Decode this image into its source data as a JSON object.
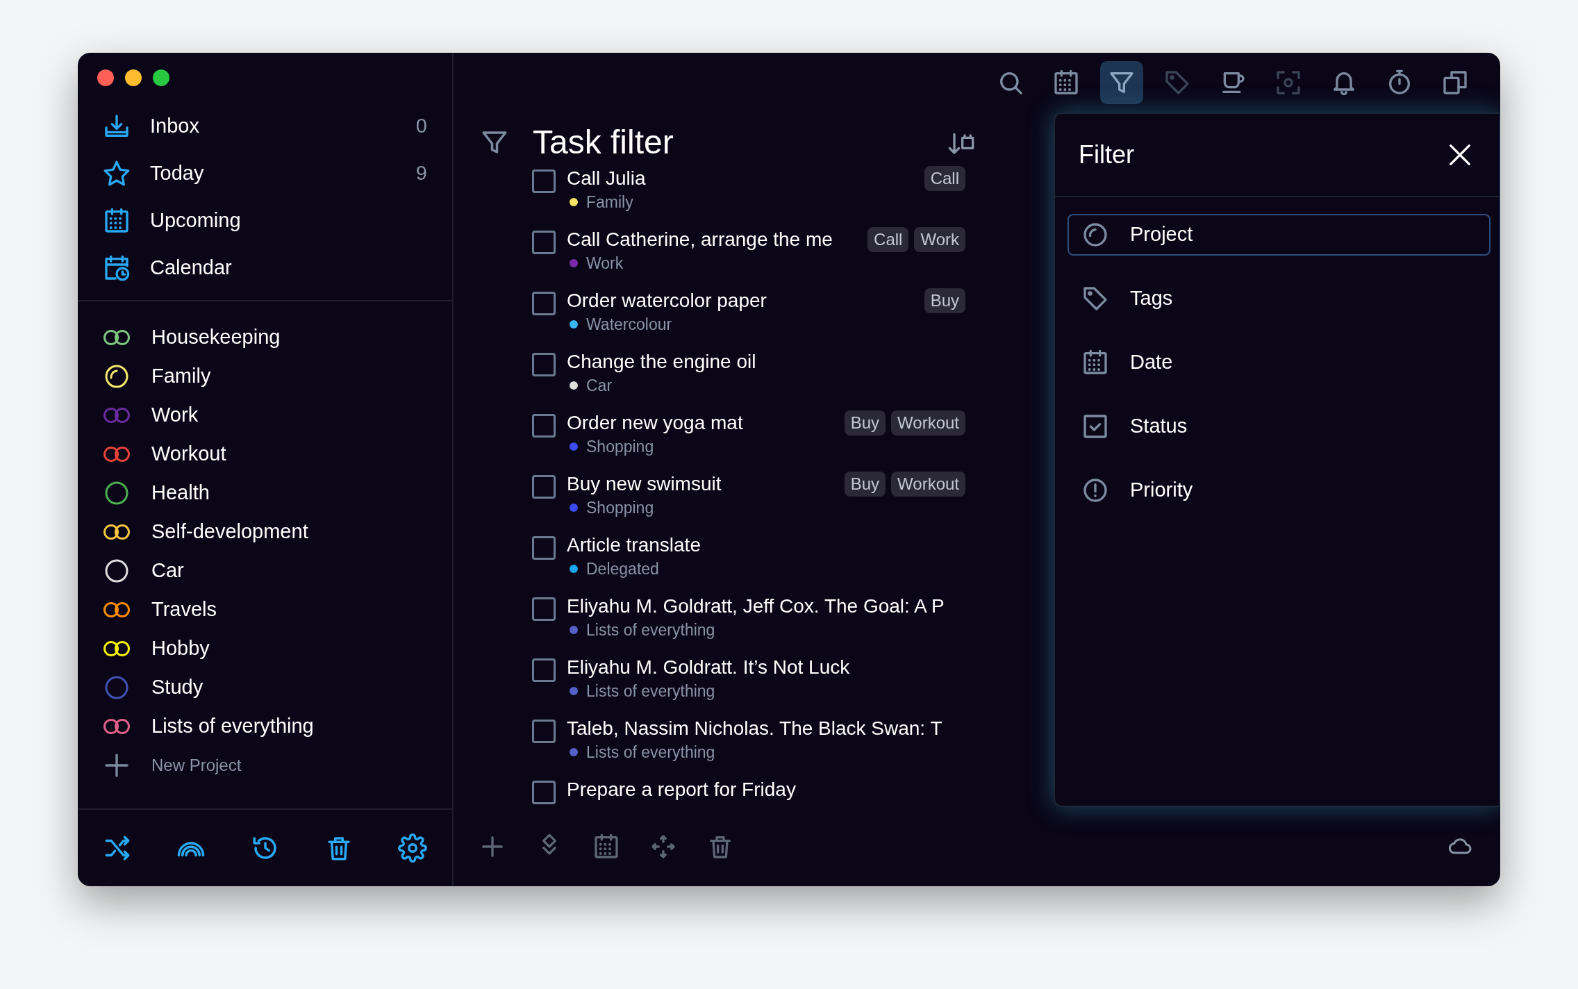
{
  "sidebar": {
    "nav": [
      {
        "label": "Inbox",
        "count": "0"
      },
      {
        "label": "Today",
        "count": "9"
      },
      {
        "label": "Upcoming"
      },
      {
        "label": "Calendar"
      }
    ],
    "projects": [
      {
        "name": "Housekeeping",
        "kind": "double",
        "color": "#7cc77f"
      },
      {
        "name": "Family",
        "kind": "partial",
        "color": "#f5e86a"
      },
      {
        "name": "Work",
        "kind": "double",
        "color": "#6a2aa0"
      },
      {
        "name": "Workout",
        "kind": "double",
        "color": "#e8433a"
      },
      {
        "name": "Health",
        "kind": "single",
        "color": "#4caf50"
      },
      {
        "name": "Self-development",
        "kind": "double",
        "color": "#f5c542"
      },
      {
        "name": "Car",
        "kind": "single",
        "color": "#dddddd"
      },
      {
        "name": "Travels",
        "kind": "double",
        "color": "#ff8c00"
      },
      {
        "name": "Hobby",
        "kind": "double",
        "color": "#f5f000"
      },
      {
        "name": "Study",
        "kind": "single",
        "color": "#3f51b5"
      },
      {
        "name": "Lists of everything",
        "kind": "double",
        "color": "#e0608a"
      }
    ],
    "new_project": "New Project"
  },
  "toolbar": [
    {
      "selected": false,
      "disabled": false
    },
    {
      "selected": false,
      "disabled": false
    },
    {
      "selected": true,
      "disabled": false
    },
    {
      "selected": false,
      "disabled": true
    },
    {
      "selected": false,
      "disabled": false
    },
    {
      "selected": false,
      "disabled": true
    },
    {
      "selected": false,
      "disabled": false
    },
    {
      "selected": false,
      "disabled": false
    },
    {
      "selected": false,
      "disabled": false
    }
  ],
  "main": {
    "title": "Task filter"
  },
  "tasks": [
    {
      "title": "Call Julia",
      "checked": false,
      "project": "Family",
      "color": "#f7e463",
      "tags": [
        "Call"
      ]
    },
    {
      "title": "Call Catherine, arrange the me",
      "checked": false,
      "project": "Work",
      "color": "#7a2aa8",
      "tags": [
        "Call",
        "Work"
      ]
    },
    {
      "title": "Order watercolor paper",
      "checked": false,
      "project": "Watercolour",
      "color": "#3ab5f0",
      "tags": [
        "Buy"
      ]
    },
    {
      "title": "Change the engine oil",
      "checked": false,
      "project": "Car",
      "color": "#dddddd"
    },
    {
      "title": "Order new yoga mat",
      "checked": false,
      "project": "Shopping",
      "color": "#3a4cf0",
      "tags": [
        "Buy",
        "Workout"
      ]
    },
    {
      "title": "Buy new swimsuit",
      "checked": false,
      "project": "Shopping",
      "color": "#3a4cf0",
      "tags": [
        "Buy",
        "Workout"
      ]
    },
    {
      "title": "Article translate",
      "checked": false,
      "project": "Delegated",
      "color": "#19a7f0"
    },
    {
      "title": "Eliyahu M. Goldratt, Jeff Cox. The Goal: A P",
      "checked": false,
      "project": "Lists of everything",
      "color": "#5560c8"
    },
    {
      "title": "Eliyahu M. Goldratt. It’s Not Luck",
      "checked": false,
      "project": "Lists of everything",
      "color": "#5560c8"
    },
    {
      "title": "Taleb, Nassim Nicholas. The Black Swan: T",
      "checked": false,
      "project": "Lists of everything",
      "color": "#5560c8"
    },
    {
      "title": "Prepare a report for Friday",
      "checked": false
    }
  ],
  "filter_panel": {
    "title": "Filter",
    "items": [
      {
        "label": "Project",
        "selected": true
      },
      {
        "label": "Tags",
        "selected": false
      },
      {
        "label": "Date",
        "selected": false
      },
      {
        "label": "Status",
        "selected": false
      },
      {
        "label": "Priority",
        "selected": false
      }
    ]
  }
}
